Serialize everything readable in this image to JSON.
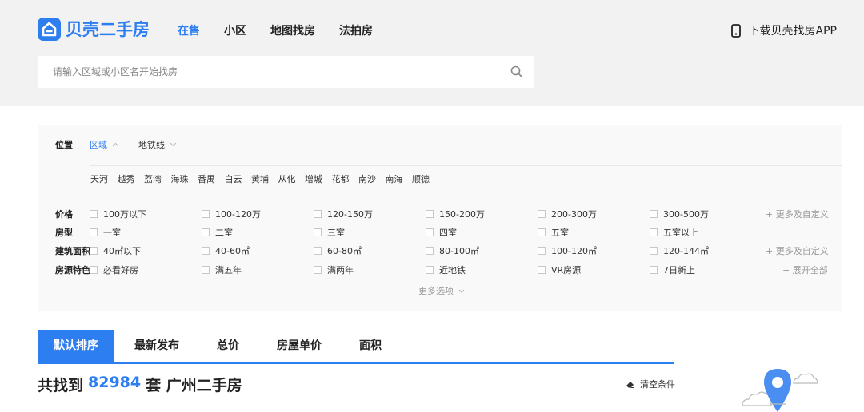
{
  "header": {
    "logo_text": "贝壳二手房",
    "nav": [
      {
        "label": "在售",
        "active": true
      },
      {
        "label": "小区",
        "active": false
      },
      {
        "label": "地图找房",
        "active": false
      },
      {
        "label": "法拍房",
        "active": false
      }
    ],
    "app_download": "下载贝壳找房APP",
    "search_placeholder": "请输入区域或小区名开始找房"
  },
  "filter": {
    "position_label": "位置",
    "position_tabs": [
      {
        "label": "区域",
        "active": true,
        "icon": "chevron-up-icon"
      },
      {
        "label": "地铁线",
        "active": false,
        "icon": "chevron-down-icon"
      }
    ],
    "districts": [
      "天河",
      "越秀",
      "荔湾",
      "海珠",
      "番禺",
      "白云",
      "黄埔",
      "从化",
      "增城",
      "花都",
      "南沙",
      "南海",
      "顺德"
    ],
    "rows": [
      {
        "label": "价格",
        "options": [
          "100万以下",
          "100-120万",
          "120-150万",
          "150-200万",
          "200-300万",
          "300-500万"
        ],
        "more": "+ 更多及自定义"
      },
      {
        "label": "房型",
        "options": [
          "一室",
          "二室",
          "三室",
          "四室",
          "五室",
          "五室以上"
        ],
        "more": ""
      },
      {
        "label": "建筑面积",
        "options": [
          "40㎡以下",
          "40-60㎡",
          "60-80㎡",
          "80-100㎡",
          "100-120㎡",
          "120-144㎡"
        ],
        "more": "+ 更多及自定义"
      },
      {
        "label": "房源特色",
        "options": [
          "必看好房",
          "满五年",
          "满两年",
          "近地铁",
          "VR房源",
          "7日新上"
        ],
        "more": "+ 展开全部"
      }
    ],
    "more_options": "更多选项"
  },
  "sort": {
    "tabs": [
      {
        "label": "默认排序",
        "active": true
      },
      {
        "label": "最新发布",
        "active": false
      },
      {
        "label": "总价",
        "active": false
      },
      {
        "label": "房屋单价",
        "active": false
      },
      {
        "label": "面积",
        "active": false
      }
    ]
  },
  "result": {
    "prefix": "共找到",
    "count": "82984",
    "suffix": "套 广州二手房",
    "clear_label": "清空条件"
  },
  "colors": {
    "accent": "#2d7ef0",
    "header_bg": "#f2f2f2",
    "filter_bg": "#f9f9f9"
  }
}
